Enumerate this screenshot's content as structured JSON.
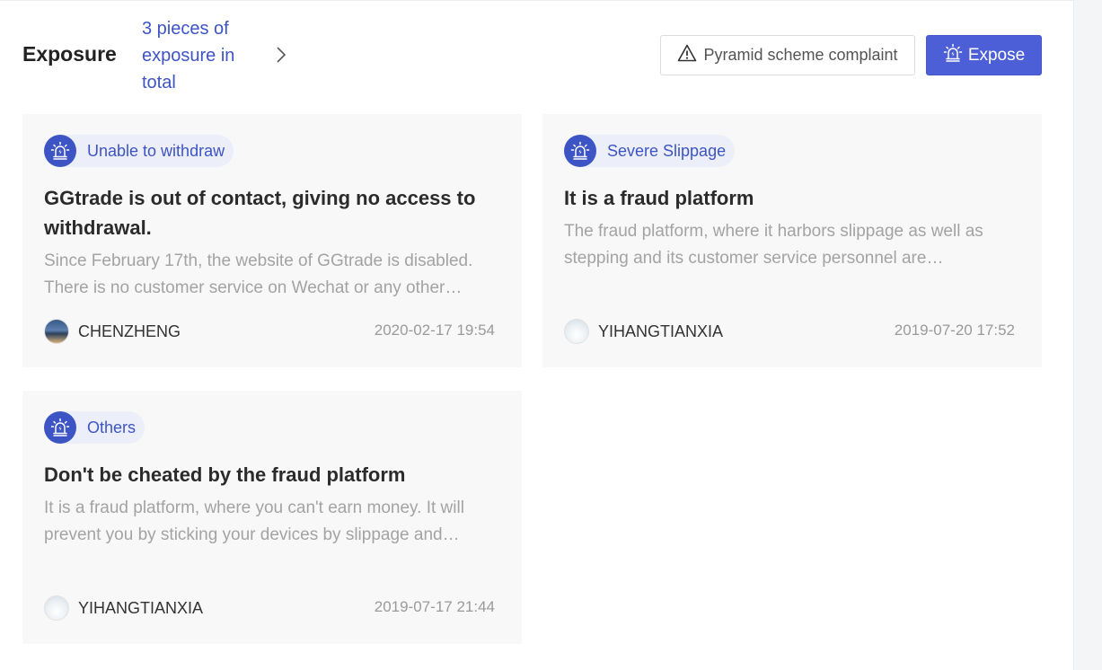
{
  "header": {
    "title": "Exposure",
    "count_text": "3 pieces of exposure in total"
  },
  "actions": {
    "complaint_label": "Pyramid scheme complaint",
    "expose_label": "Expose"
  },
  "colors": {
    "accent": "#3d54c4",
    "button_primary": "#4d5fd6",
    "card_bg": "#f8f8f9",
    "muted_text": "#a3a3a3"
  },
  "cards": [
    {
      "tag": "Unable to withdraw",
      "title": "GGtrade is out of contact, giving no access to withdrawal.",
      "body": "Since February 17th, the website of GGtrade is disabled. There is no customer service on Wechat or any other contact method available.",
      "author": "CHENZHENG",
      "date": "2020-02-17 19:54"
    },
    {
      "tag": "Severe Slippage",
      "title": "It is a fraud platform",
      "body": "The fraud platform, where it harbors slippage as well as stepping and its customer service personnel are unreachable.",
      "author": "YIHANGTIANXIA",
      "date": "2019-07-20 17:52"
    },
    {
      "tag": "Others",
      "title": "Don't be cheated by the fraud platform",
      "body": "It is a fraud platform, where you can't earn money. It will prevent you by sticking your devices by slippage and stepping.",
      "author": "YIHANGTIANXIA",
      "date": "2019-07-17 21:44"
    }
  ],
  "icons": {
    "chevron": "chevron-right-icon",
    "warning": "warning-triangle-icon",
    "alarm": "alarm-siren-icon"
  }
}
